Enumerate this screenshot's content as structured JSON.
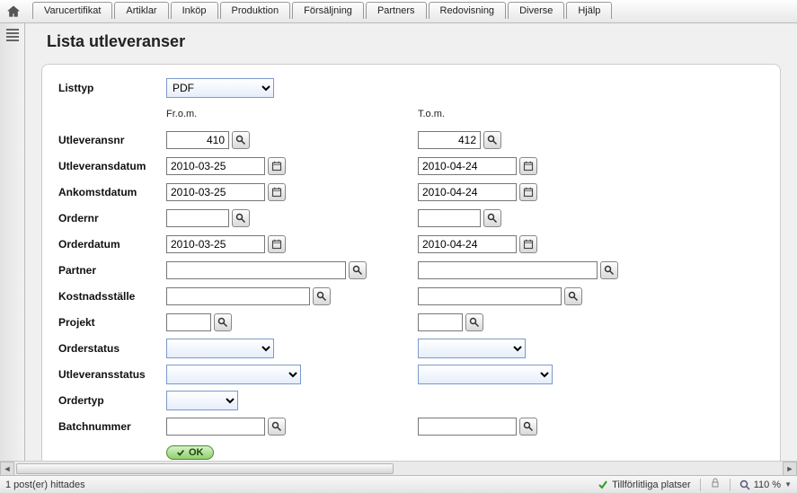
{
  "tabs": [
    "Varucertifikat",
    "Artiklar",
    "Inköp",
    "Produktion",
    "Försäljning",
    "Partners",
    "Redovisning",
    "Diverse",
    "Hjälp"
  ],
  "page_title": "Lista utleveranser",
  "labels": {
    "listtyp": "Listtyp",
    "from": "Fr.o.m.",
    "to": "T.o.m.",
    "utleveransnr": "Utleveransnr",
    "utleveransdatum": "Utleveransdatum",
    "ankomstdatum": "Ankomstdatum",
    "ordernr": "Ordernr",
    "orderdatum": "Orderdatum",
    "partner": "Partner",
    "kostnadsstalle": "Kostnadsställe",
    "projekt": "Projekt",
    "orderstatus": "Orderstatus",
    "utleveransstatus": "Utleveransstatus",
    "ordertyp": "Ordertyp",
    "batchnummer": "Batchnummer"
  },
  "values": {
    "listtyp": "PDF",
    "utleveransnr_from": "410",
    "utleveransnr_to": "412",
    "utleveransdatum_from": "2010-03-25",
    "utleveransdatum_to": "2010-04-24",
    "ankomstdatum_from": "2010-03-25",
    "ankomstdatum_to": "2010-04-24",
    "ordernr_from": "",
    "ordernr_to": "",
    "orderdatum_from": "2010-03-25",
    "orderdatum_to": "2010-04-24",
    "partner_from": "",
    "partner_to": "",
    "kostnadsstalle_from": "",
    "kostnadsstalle_to": "",
    "projekt_from": "",
    "projekt_to": "",
    "orderstatus_from": "",
    "orderstatus_to": "",
    "utleveransstatus_from": "",
    "utleveransstatus_to": "",
    "ordertyp": "",
    "batchnummer_from": "",
    "batchnummer_to": ""
  },
  "buttons": {
    "ok": "OK"
  },
  "status": {
    "left": "1 post(er) hittades",
    "trusted": "Tillförlitliga platser",
    "zoom": "110 %"
  }
}
